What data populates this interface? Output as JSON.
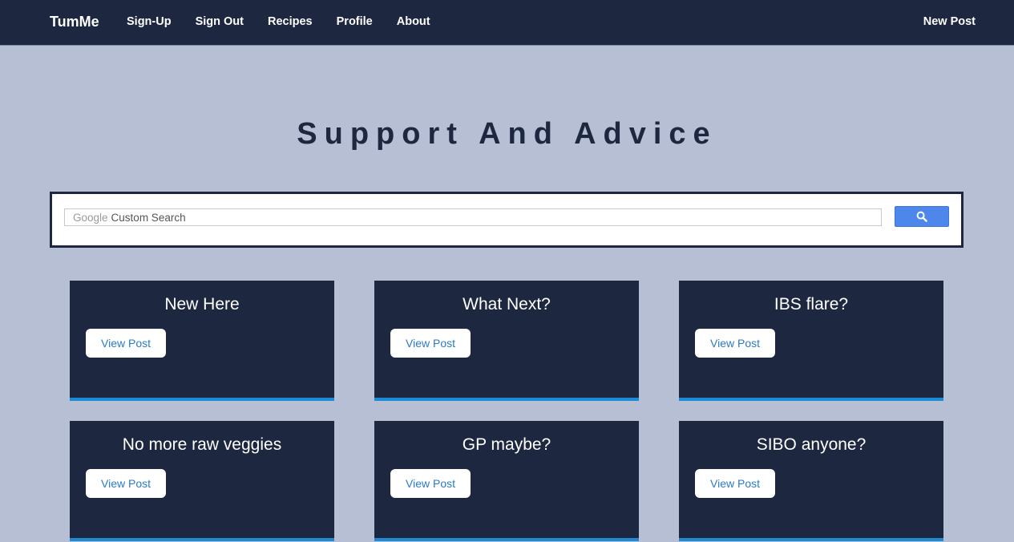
{
  "navbar": {
    "brand": "TumMe",
    "links": [
      "Sign-Up",
      "Sign Out",
      "Recipes",
      "Profile",
      "About"
    ],
    "right_link": "New Post"
  },
  "page": {
    "title": "Support And Advice"
  },
  "search": {
    "brand": "Google",
    "placeholder": "Custom Search",
    "button_icon": "search-icon",
    "button_color": "#4d87ec"
  },
  "posts": [
    {
      "title": "New Here",
      "button": "View Post"
    },
    {
      "title": "What Next?",
      "button": "View Post"
    },
    {
      "title": "IBS flare?",
      "button": "View Post"
    },
    {
      "title": "No more raw veggies",
      "button": "View Post"
    },
    {
      "title": "GP maybe?",
      "button": "View Post"
    },
    {
      "title": "SIBO anyone?",
      "button": "View Post"
    }
  ],
  "colors": {
    "navbar": "#1e2740",
    "background": "#b6bfd3",
    "card": "#1e2740",
    "card_accent": "#1d8ad6",
    "link_text": "#2b7bc5"
  }
}
